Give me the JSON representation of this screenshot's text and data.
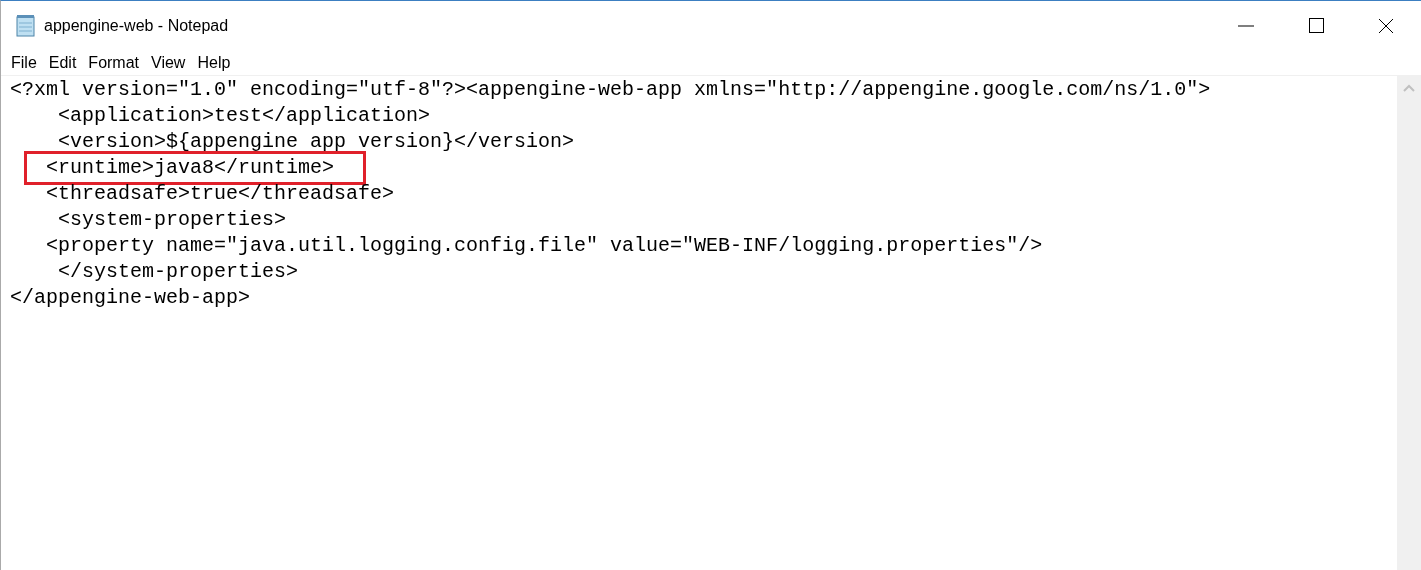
{
  "window": {
    "title": "appengine-web - Notepad"
  },
  "menu": [
    "File",
    "Edit",
    "Format",
    "View",
    "Help"
  ],
  "editor": {
    "lines": [
      {
        "text": "<?xml version=\"1.0\" encoding=\"utf-8\"?><appengine-web-app xmlns=\"http://appengine.google.com/ns/1.0\">",
        "highlighted": false
      },
      {
        "text": "    <application>test</application>",
        "highlighted": false
      },
      {
        "text": "    <version>${appengine app version}</version>",
        "highlighted": false
      },
      {
        "text": "   <runtime>java8</runtime>",
        "highlighted": true
      },
      {
        "text": "   <threadsafe>true</threadsafe>",
        "highlighted": false
      },
      {
        "text": "    <system-properties>",
        "highlighted": false
      },
      {
        "text": "   <property name=\"java.util.logging.config.file\" value=\"WEB-INF/logging.properties\"/>",
        "highlighted": false
      },
      {
        "text": "    </system-properties>",
        "highlighted": false
      },
      {
        "text": "</appengine-web-app>",
        "highlighted": false
      }
    ]
  }
}
